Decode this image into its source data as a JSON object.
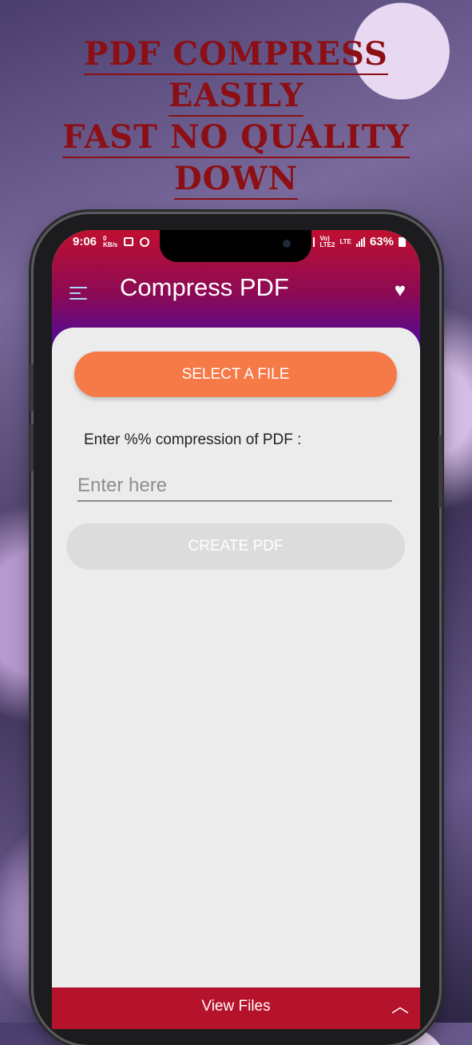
{
  "promo": {
    "line1": "PDF COMPRESS",
    "line2": "EASILY",
    "line3": "FAST NO QUALITY",
    "line4": "DOWN"
  },
  "status_bar": {
    "time": "9:06",
    "battery": "63%",
    "network1": "Vo))\nLTE2",
    "network2": "LTE"
  },
  "app_bar": {
    "title": "Compress PDF",
    "menu_icon": "hamburger-menu-icon",
    "favorite_icon": "heart-icon"
  },
  "main": {
    "select_button": "SELECT A FILE",
    "prompt": "Enter %% compression of PDF :",
    "input_placeholder": "Enter here",
    "input_value": "",
    "create_button": "CREATE PDF"
  },
  "bottom_bar": {
    "label": "View Files",
    "icon": "chevron-up-icon"
  },
  "colors": {
    "headline": "#8b0f14",
    "select_button": "#f67a48",
    "create_button_disabled": "#dcdcdc",
    "bottom_bar": "#b5122b"
  }
}
